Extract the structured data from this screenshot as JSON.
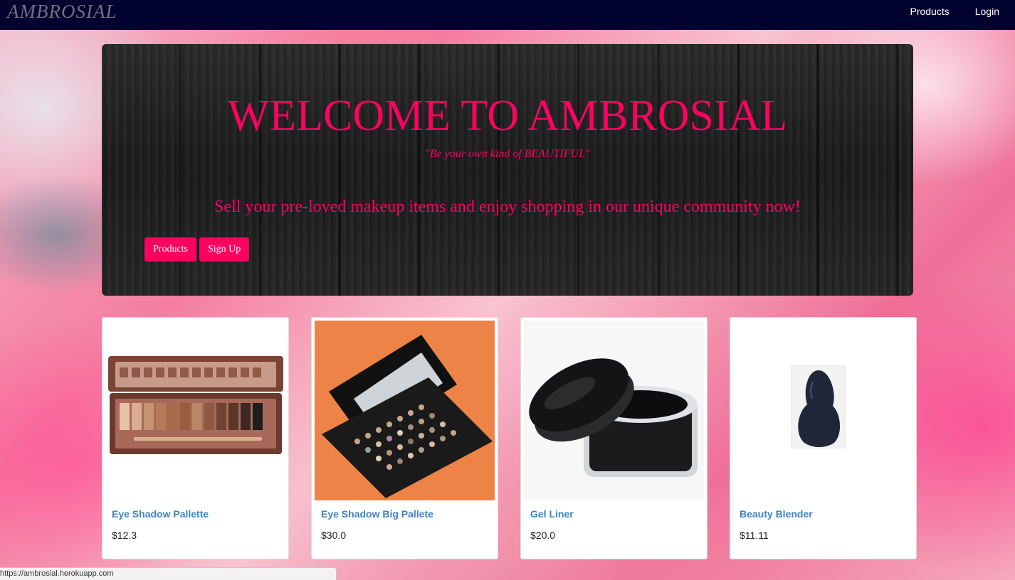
{
  "navbar": {
    "brand": "AMBROSIAL",
    "links": [
      "Products",
      "Login"
    ]
  },
  "hero": {
    "title": "WELCOME TO AMBROSIAL",
    "tagline": "\"Be your own kind of BEAUTIFUL\"",
    "text": "Sell your pre-loved makeup items and enjoy shopping in our unique community now!",
    "buttons": [
      "Products",
      "Sign Up"
    ]
  },
  "products": [
    {
      "name": "Eye Shadow Pallette",
      "price": "$12.3",
      "image": "eyeshadow-palette-image"
    },
    {
      "name": "Eye Shadow Big Pallete",
      "price": "$30.0",
      "image": "big-palette-image"
    },
    {
      "name": "Gel Liner",
      "price": "$20.0",
      "image": "gel-liner-image"
    },
    {
      "name": "Beauty Blender",
      "price": "$11.11",
      "image": "beauty-blender-image"
    }
  ],
  "statusbar": {
    "url": "https://ambrosial.herokuapp.com"
  },
  "colors": {
    "accent": "#f8045f",
    "navbar": "#02022e",
    "link": "#3c83c2"
  }
}
